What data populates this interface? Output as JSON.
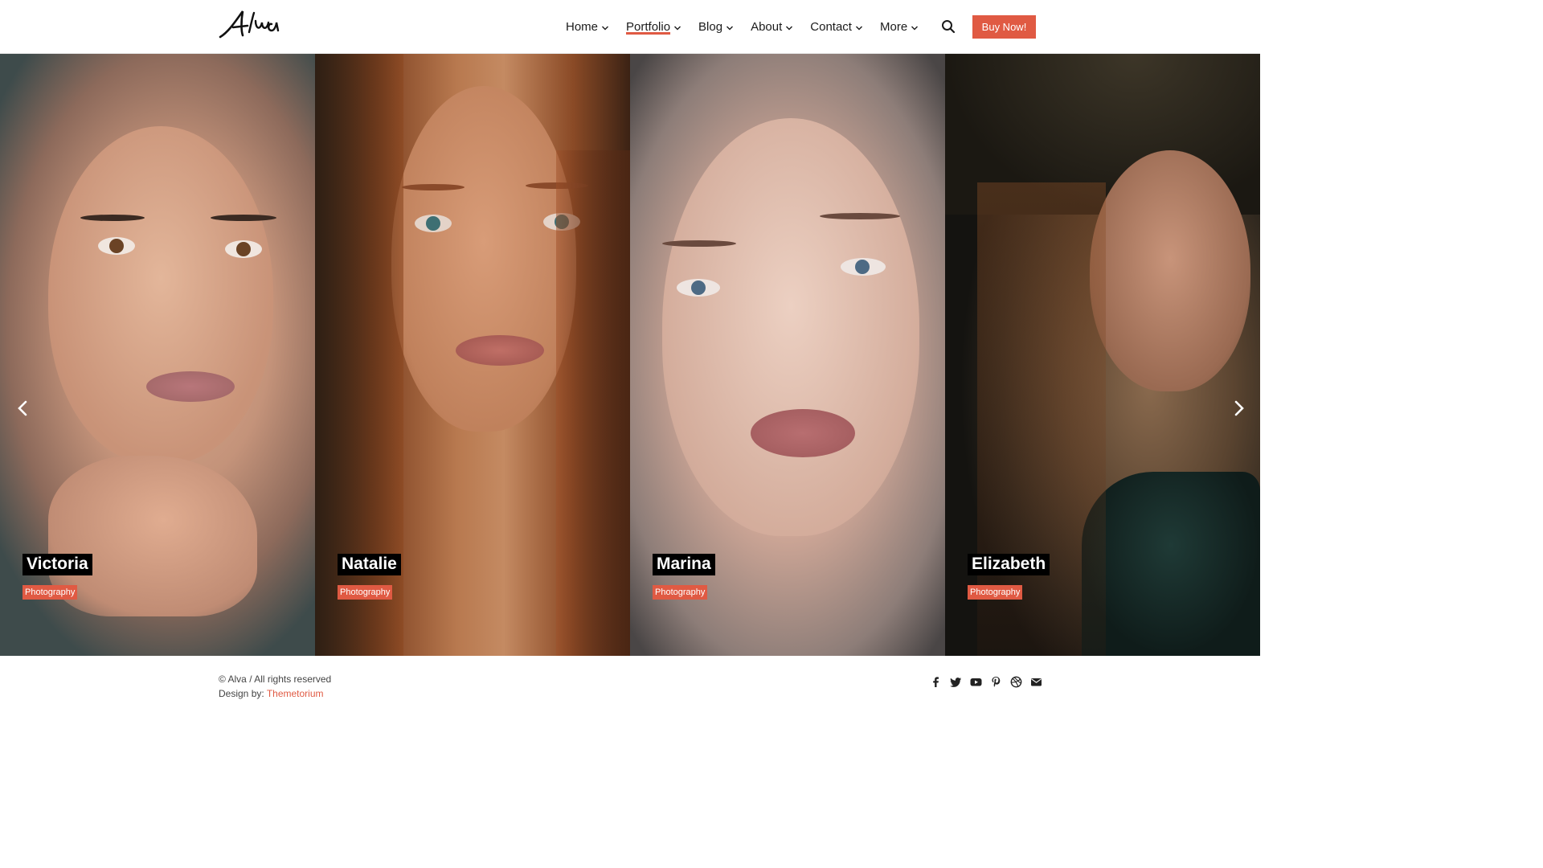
{
  "brand": {
    "logo_text": "Alva",
    "accent": "#e05a43"
  },
  "nav": {
    "items": [
      {
        "label": "Home"
      },
      {
        "label": "Portfolio"
      },
      {
        "label": "Blog"
      },
      {
        "label": "About"
      },
      {
        "label": "Contact"
      },
      {
        "label": "More"
      }
    ],
    "active": "Portfolio",
    "buy_label": "Buy Now!"
  },
  "gallery": {
    "items": [
      {
        "name": "Victoria",
        "category": "Photography"
      },
      {
        "name": "Natalie",
        "category": "Photography"
      },
      {
        "name": "Marina",
        "category": "Photography"
      },
      {
        "name": "Elizabeth",
        "category": "Photography"
      }
    ]
  },
  "footer": {
    "copyright": "© Alva / All rights reserved",
    "design_prefix": "Design by:",
    "design_link": "Themetorium",
    "socials": [
      "facebook-icon",
      "twitter-icon",
      "youtube-icon",
      "pinterest-icon",
      "dribbble-icon",
      "email-icon"
    ]
  }
}
